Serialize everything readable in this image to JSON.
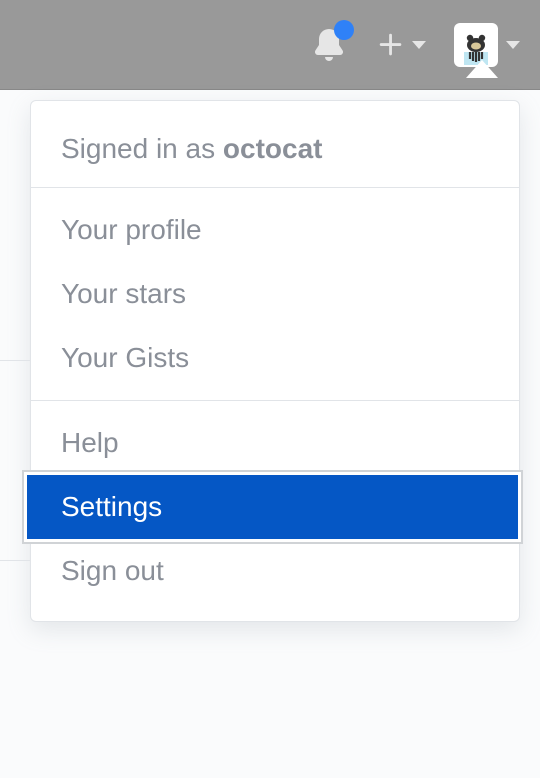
{
  "header": {
    "notification_indicator": true
  },
  "user": {
    "name": "octocat"
  },
  "dropdown": {
    "signed_in_prefix": "Signed in as ",
    "items_group1": [
      "Your profile",
      "Your stars",
      "Your Gists"
    ],
    "items_group2": [
      "Help",
      "Settings",
      "Sign out"
    ],
    "highlighted": "Settings"
  }
}
